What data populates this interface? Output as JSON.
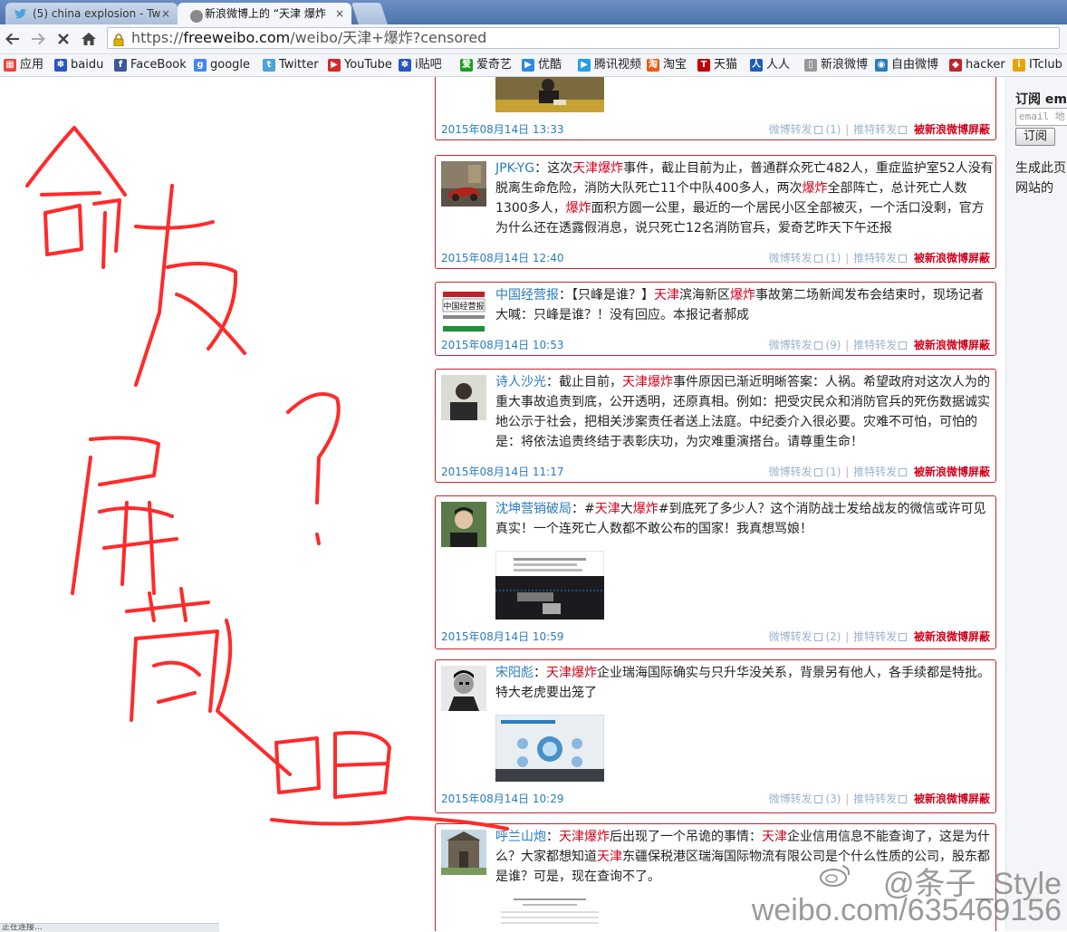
{
  "browser": {
    "tabs": [
      {
        "label": "(5) china explosion - Tw",
        "active": false,
        "icon": "twitter-icon"
      },
      {
        "label": "新浪微博上的 “天津 爆炸",
        "active": true,
        "icon": "loading-icon"
      }
    ],
    "close_glyph": "×",
    "url": {
      "scheme": "https://",
      "host": "freeweibo.com",
      "path": "/weibo/天津+爆炸?censored"
    },
    "bookmarks": [
      {
        "label": "应用",
        "icon": "apps-grid-icon",
        "color": "#e8453c"
      },
      {
        "label": "baidu",
        "icon": "paw-icon",
        "color": "#2b55c7"
      },
      {
        "label": "FaceBook",
        "icon": "facebook-icon",
        "color": "#3b5998"
      },
      {
        "label": "google",
        "icon": "google-icon",
        "color": "#4285f4"
      },
      {
        "label": "Twitter",
        "icon": "twitter-icon",
        "color": "#4aa3df"
      },
      {
        "label": "YouTube",
        "icon": "youtube-icon",
        "color": "#d9252a"
      },
      {
        "label": "i贴吧",
        "icon": "paw-icon",
        "color": "#2b55c7"
      },
      {
        "label": "爱奇艺",
        "icon": "iqiyi-icon",
        "color": "#19a01b"
      },
      {
        "label": "优酷",
        "icon": "youku-icon",
        "color": "#2b8be0"
      },
      {
        "label": "腾讯视频",
        "icon": "tencent-video-icon",
        "color": "#23a0e8"
      },
      {
        "label": "淘宝",
        "icon": "taobao-icon",
        "color": "#f25a0c"
      },
      {
        "label": "天猫",
        "icon": "tmall-icon",
        "color": "#c40000"
      },
      {
        "label": "人人",
        "icon": "renren-icon",
        "color": "#1d5fb8"
      },
      {
        "label": "新浪微博",
        "icon": "page-icon",
        "color": "#999999"
      },
      {
        "label": "自由微博",
        "icon": "freeweibo-icon",
        "color": "#2a7bbf"
      },
      {
        "label": "hacker",
        "icon": "shield-icon",
        "color": "#c0262d"
      },
      {
        "label": "ITclub",
        "icon": "itclub-icon",
        "color": "#e8a400"
      }
    ]
  },
  "feed": {
    "posts": [
      {
        "date": "2015年08月14日 13:33",
        "repost_count": "(1)"
      },
      {
        "author": "JPK-YG",
        "segments": [
          {
            "t": "：这次"
          },
          {
            "t": "天津",
            "kw": true
          },
          {
            "t": "爆炸",
            "kw": true
          },
          {
            "t": "事件，截止目前为止，普通群众死亡482人，重症监护室52人没有脱离生命危险，消防大队死亡11个中队400多人，两次"
          },
          {
            "t": "爆炸",
            "kw": true
          },
          {
            "t": "全部阵亡，总计死亡人数1300多人，"
          },
          {
            "t": "爆炸",
            "kw": true
          },
          {
            "t": "面积方圆一公里，最近的一个居民小区全部被灭，一个活口没剩，官方为什么还在透露假消息，说只死亡12名消防官兵，爱奇艺昨天下午还报"
          }
        ],
        "date": "2015年08月14日 12:40",
        "repost_count": "(1)"
      },
      {
        "author": "中国经营报",
        "segments": [
          {
            "t": "：【只峰是谁？】"
          },
          {
            "t": "天津",
            "kw": true
          },
          {
            "t": "滨海新区"
          },
          {
            "t": "爆炸",
            "kw": true
          },
          {
            "t": "事故第二场新闻发布会结束时，现场记者大喊：只峰是谁？！没有回应。本报记者郝成"
          }
        ],
        "date": "2015年08月14日 10:53",
        "repost_count": "(9)"
      },
      {
        "author": "诗人沙光",
        "segments": [
          {
            "t": "：截止目前，"
          },
          {
            "t": "天津",
            "kw": true
          },
          {
            "t": "爆炸",
            "kw": true
          },
          {
            "t": "事件原因已渐近明晰答案：人祸。希望政府对这次人为的重大事故追责到底，公开透明，还原真相。例如：把受灾民众和消防官兵的死伤数据诚实地公示于社会，把相关涉案责任者送上法庭。中纪委介入很必要。灾难不可怕，可怕的是：将依法追责终结于表彰庆功，为灾难重演搭台。请尊重生命！"
          }
        ],
        "date": "2015年08月14日 11:17",
        "repost_count": "(1)"
      },
      {
        "author": "沈坤营销破局",
        "segments": [
          {
            "t": "：#"
          },
          {
            "t": "天津",
            "kw": true
          },
          {
            "t": "大"
          },
          {
            "t": "爆炸",
            "kw": true
          },
          {
            "t": "#到底死了多少人？这个消防战士发给战友的微信或许可见真实！一个连死亡人数都不敢公布的国家！我真想骂娘！"
          }
        ],
        "date": "2015年08月14日 10:59",
        "repost_count": "(2)"
      },
      {
        "author": "宋阳彪",
        "segments": [
          {
            "t": "："
          },
          {
            "t": "天津",
            "kw": true
          },
          {
            "t": "爆炸",
            "kw": true
          },
          {
            "t": "企业瑞海国际确实与只升华没关系，背景另有他人，各手续都是特批。特大老虎要出笼了"
          }
        ],
        "date": "2015年08月14日 10:29",
        "repost_count": "(3)"
      },
      {
        "author": "呼兰山炮",
        "segments": [
          {
            "t": "："
          },
          {
            "t": "天津",
            "kw": true
          },
          {
            "t": "爆炸",
            "kw": true
          },
          {
            "t": "后出现了一个吊诡的事情："
          },
          {
            "t": "天津",
            "kw": true
          },
          {
            "t": "企业信用信息不能查询了，这是为什么？大家都想知道"
          },
          {
            "t": "天津",
            "kw": true
          },
          {
            "t": "东疆保税港区瑞海国际物流有限公司是个什么性质的公司，股东都是谁？可是，现在查询不了。"
          }
        ]
      }
    ],
    "labels": {
      "repost": "微博转发",
      "tweet_repost": "推特转发",
      "blocked": "被新浪微博屏蔽",
      "separator": "|"
    }
  },
  "sidebar": {
    "title": "订阅 ema",
    "email_placeholder": "email 地",
    "subscribe_button": "订阅",
    "text": "生成此页高网站的"
  },
  "statusbar": {
    "text": "正在连接..."
  },
  "watermark": {
    "handle": "@条子_Style",
    "url": "weibo.com/635469156"
  },
  "annotation": {
    "color": "#ff2a2a"
  }
}
